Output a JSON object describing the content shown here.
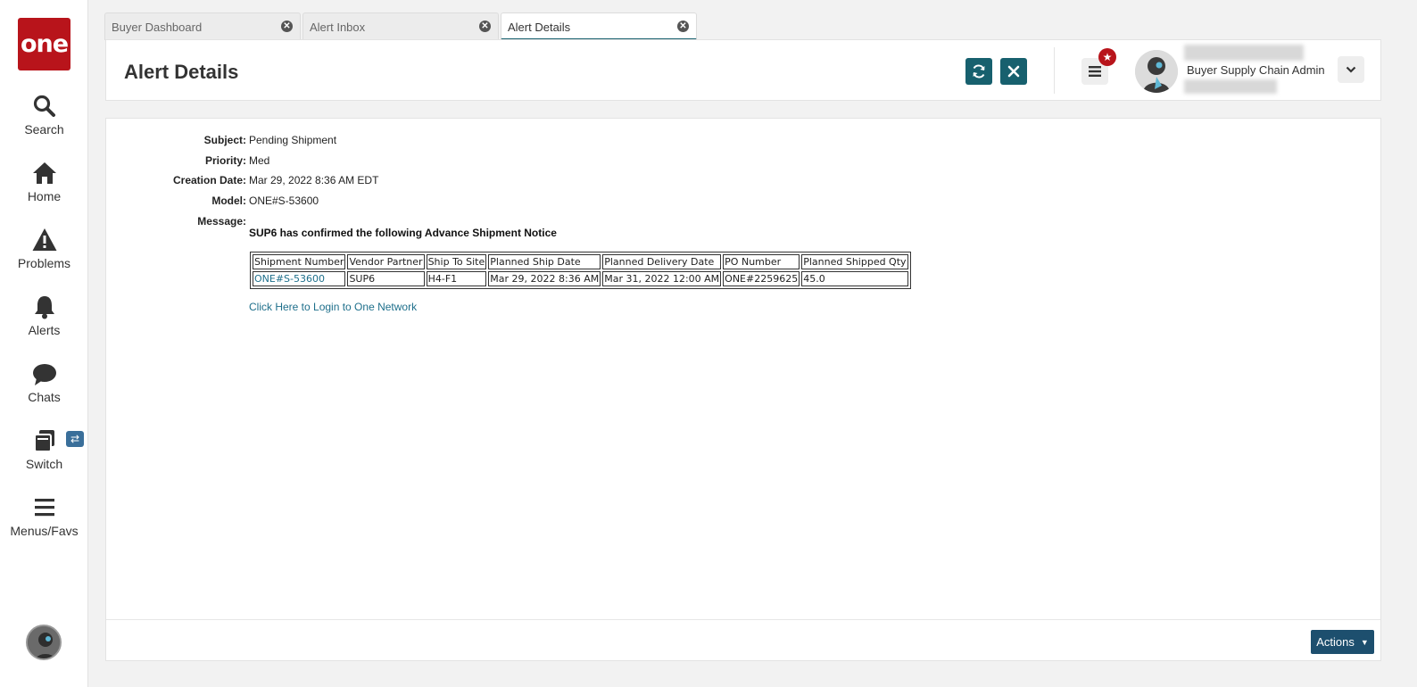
{
  "sidebar": {
    "logo_text": "one",
    "items": [
      {
        "label": "Search",
        "icon": "search-icon"
      },
      {
        "label": "Home",
        "icon": "home-icon"
      },
      {
        "label": "Problems",
        "icon": "warning-icon"
      },
      {
        "label": "Alerts",
        "icon": "bell-icon"
      },
      {
        "label": "Chats",
        "icon": "chat-icon"
      },
      {
        "label": "Switch",
        "icon": "switch-icon",
        "badge_icon": "swap-icon"
      },
      {
        "label": "Menus/Favs",
        "icon": "menu-icon"
      }
    ]
  },
  "tabs": [
    {
      "label": "Buyer Dashboard",
      "active": false
    },
    {
      "label": "Alert Inbox",
      "active": false
    },
    {
      "label": "Alert Details",
      "active": true
    }
  ],
  "header": {
    "title": "Alert Details",
    "user_role": "Buyer Supply Chain Admin",
    "accent_color": "#17606e",
    "badge_color": "#b8141b"
  },
  "details": {
    "subject_label": "Subject:",
    "subject_value": "Pending Shipment",
    "priority_label": "Priority:",
    "priority_value": "Med",
    "creation_label": "Creation Date:",
    "creation_value": "Mar 29, 2022 8:36 AM EDT",
    "model_label": "Model:",
    "model_value": "ONE#S-53600",
    "message_label": "Message:"
  },
  "message": {
    "heading": "SUP6 has confirmed the following Advance Shipment Notice",
    "table": {
      "headers": [
        "Shipment Number",
        "Vendor Partner",
        "Ship To Site",
        "Planned Ship Date",
        "Planned Delivery Date",
        "PO Number",
        "Planned Shipped Qty"
      ],
      "row": [
        "ONE#S-53600",
        "SUP6",
        "H4-F1",
        "Mar 29, 2022 8:36 AM",
        "Mar 31, 2022 12:00 AM",
        "ONE#2259625",
        "45.0"
      ]
    },
    "login_link": "Click Here to Login to One Network"
  },
  "footer": {
    "actions_label": "Actions"
  }
}
